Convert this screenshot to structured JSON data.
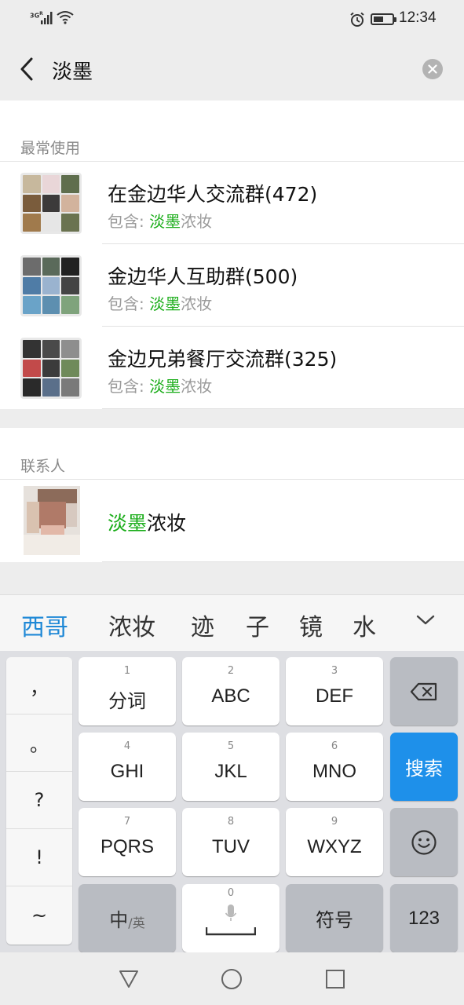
{
  "status_bar": {
    "network": "3G",
    "network_sup": "R",
    "time": "12:34",
    "battery_percent": 55,
    "icons": [
      "signal-icon",
      "wifi-icon",
      "alarm-icon",
      "battery-icon"
    ]
  },
  "search": {
    "query": "淡墨",
    "back_icon": "back-arrow-icon",
    "clear_icon": "clear-icon"
  },
  "frequent": {
    "title": "最常使用",
    "items": [
      {
        "name": "在金边华人交流群(472)",
        "contains_prefix": "包含: ",
        "match": "淡墨",
        "rest": "浓妆",
        "avatar_colors": [
          "#c7b89d",
          "#e9d6d8",
          "#5f6e4d",
          "#7a5c3c",
          "#3c3a3a",
          "#d2b39d",
          "#a07a4c",
          "#e6e6e6",
          "#6a7350"
        ]
      },
      {
        "name": "金边华人互助群(500)",
        "contains_prefix": "包含: ",
        "match": "淡墨",
        "rest": "浓妆",
        "avatar_colors": [
          "#6c6c6c",
          "#5a6a5a",
          "#222",
          "#4f7ca6",
          "#9ab3cf",
          "#444",
          "#6aa3c8",
          "#5d8fb0",
          "#7fa37c"
        ]
      },
      {
        "name": "金边兄弟餐厅交流群(325)",
        "contains_prefix": "包含: ",
        "match": "淡墨",
        "rest": "浓妆",
        "avatar_colors": [
          "#333",
          "#4a4a4a",
          "#8e8e8e",
          "#c24a4a",
          "#3b3b3b",
          "#6f8a5a",
          "#2a2a2a",
          "#5a6f8a",
          "#7a7a7a"
        ]
      }
    ]
  },
  "contacts": {
    "title": "联系人",
    "items": [
      {
        "match": "淡墨",
        "rest": "浓妆"
      }
    ]
  },
  "candidates": {
    "items": [
      "西哥",
      "浓妆",
      "迹",
      "子",
      "镜",
      "水"
    ],
    "expand_icon": "chevron-down-icon"
  },
  "keyboard": {
    "symbols": [
      "，",
      "。",
      "?",
      "!",
      "~"
    ],
    "rows": [
      [
        {
          "num": "1",
          "label": "分词"
        },
        {
          "num": "2",
          "label": "ABC"
        },
        {
          "num": "3",
          "label": "DEF"
        }
      ],
      [
        {
          "num": "4",
          "label": "GHI"
        },
        {
          "num": "5",
          "label": "JKL"
        },
        {
          "num": "6",
          "label": "MNO"
        }
      ],
      [
        {
          "num": "7",
          "label": "PQRS"
        },
        {
          "num": "8",
          "label": "TUV"
        },
        {
          "num": "9",
          "label": "WXYZ"
        }
      ]
    ],
    "lang_main": "中",
    "lang_sub": "/英",
    "space_num": "0",
    "symbols_key": "符号",
    "num_key": "123",
    "search_key": "搜索",
    "accent_color": "#1e90ea"
  },
  "nav_bar": {
    "icons": [
      "back-triangle-icon",
      "home-circle-icon",
      "recents-square-icon"
    ]
  }
}
